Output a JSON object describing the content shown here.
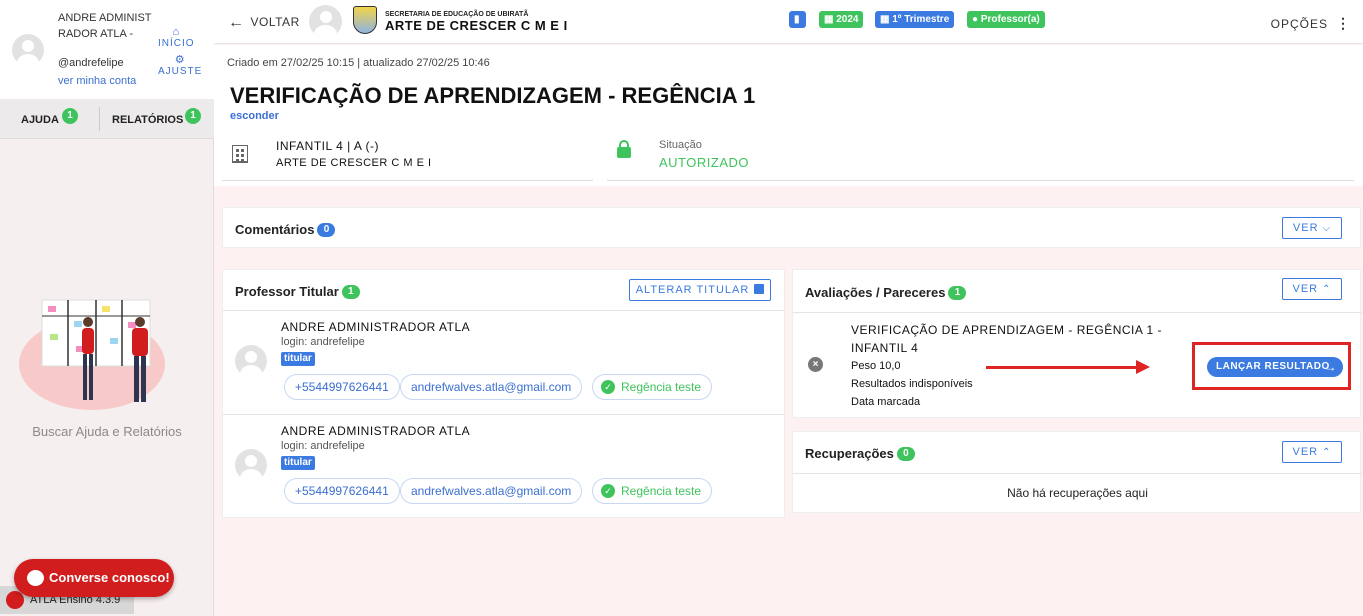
{
  "user": {
    "name": "ANDRE ADMINISTRADOR ATLA -",
    "login": "@andrefelipe",
    "account_link": "ver minha conta"
  },
  "nav": {
    "home": "INÍCIO",
    "settings": "AJUSTE"
  },
  "sidebar_tabs": [
    {
      "label": "AJUDA",
      "badge": "1"
    },
    {
      "label": "RELATÓRIOS",
      "badge": "1"
    }
  ],
  "help": {
    "caption": "Buscar Ajuda e Relatórios"
  },
  "chat": {
    "label": "Converse conosco!"
  },
  "version": "ATLA Ensino 4.3.9",
  "topbar": {
    "back": "VOLTAR",
    "school_sub": "SECRETARIA DE EDUCAÇÃO DE UBIRATÃ",
    "school_name": "ARTE DE CRESCER C M E I",
    "chips": [
      "",
      "2024",
      "1º Trimestre",
      "Professor(a)"
    ],
    "options": "OPÇÕES"
  },
  "colors": {
    "accent": "#3b7ae0",
    "success": "#3fc45d",
    "danger": "#e02424"
  },
  "page": {
    "meta": "Criado em 27/02/25 10:15 | atualizado 27/02/25 10:46",
    "title": "VERIFICAÇÃO DE APRENDIZAGEM - REGÊNCIA 1",
    "hide": "esconder",
    "class_name": "INFANTIL 4 | A (-)",
    "class_school": "ARTE DE CRESCER C M E I",
    "status_label": "Situação",
    "status_value": "AUTORIZADO"
  },
  "comments": {
    "title": "Comentários",
    "count": "0",
    "button": "VER"
  },
  "professors": {
    "title": "Professor Titular",
    "count": "1",
    "change_button": "ALTERAR TITULAR",
    "items": [
      {
        "name": "ANDRE ADMINISTRADOR ATLA",
        "login": "login: andrefelipe",
        "tag": "titular",
        "phone": "+5544997626441",
        "email": "andrefwalves.atla@gmail.com",
        "subject": "Regência teste"
      },
      {
        "name": "ANDRE ADMINISTRADOR ATLA",
        "login": "login: andrefelipe",
        "tag": "titular",
        "phone": "+5544997626441",
        "email": "andrefwalves.atla@gmail.com",
        "subject": "Regência teste"
      }
    ]
  },
  "evaluations": {
    "title": "Avaliações / Pareceres",
    "count": "1",
    "button": "VER",
    "item": {
      "title": "VERIFICAÇÃO DE APRENDIZAGEM - REGÊNCIA 1 - INFANTIL 4",
      "weight": "Peso 10,0",
      "results": "Resultados indisponíveis",
      "date": "Data marcada",
      "launch_button": "LANÇAR RESULTADO"
    }
  },
  "recoveries": {
    "title": "Recuperações",
    "count": "0",
    "button": "VER",
    "empty": "Não há recuperações aqui"
  }
}
